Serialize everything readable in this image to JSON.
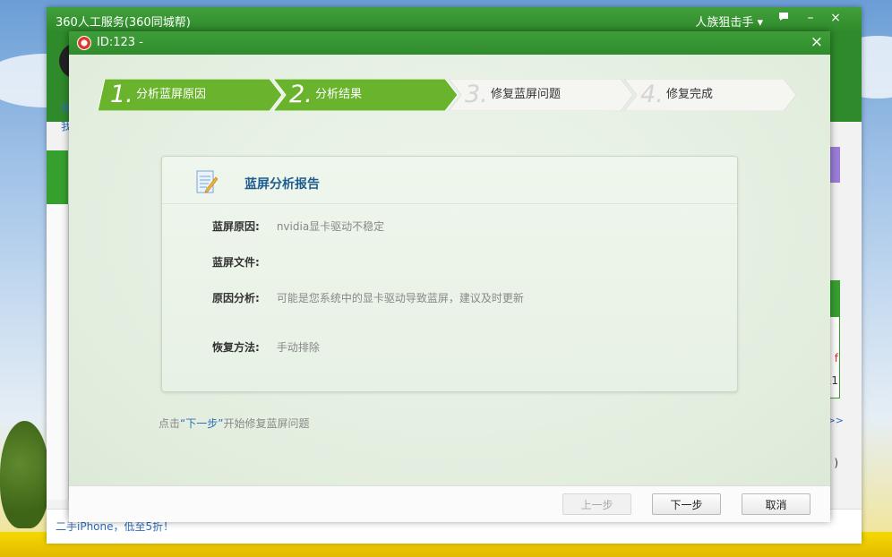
{
  "background": {
    "back_window": {
      "title": "360人工服务(360同城帮)",
      "user_menu": "人族狙击手",
      "feedback_icon": "chat-icon",
      "minimize_icon": "minus",
      "close_icon": "×",
      "side_text_1": "我",
      "side_text_2": "我",
      "right_link": ">>",
      "right_char_1": "f",
      "right_char_2": "11",
      "right_char_3": ")",
      "bottom_link": "二手iPhone，低至5折！"
    }
  },
  "dialog": {
    "title": "ID:123 -",
    "close_label": "×",
    "steps": [
      {
        "num": "1.",
        "label": "分析蓝屏原因",
        "state": "done"
      },
      {
        "num": "2.",
        "label": "分析结果",
        "state": "done"
      },
      {
        "num": "3.",
        "label": "修复蓝屏问题",
        "state": "todo"
      },
      {
        "num": "4.",
        "label": "修复完成",
        "state": "todo"
      }
    ],
    "report": {
      "title": "蓝屏分析报告",
      "rows": [
        {
          "key": "蓝屏原因:",
          "value": "nvidia显卡驱动不稳定"
        },
        {
          "key": "蓝屏文件:",
          "value": ""
        },
        {
          "key": "原因分析:",
          "value": "可能是您系统中的显卡驱动导致蓝屏，建议及时更新"
        },
        {
          "key": "恢复方法:",
          "value": "手动排除"
        }
      ]
    },
    "hint": {
      "prefix": "点击",
      "highlight": "“下一步”",
      "suffix": "开始修复蓝屏问题"
    },
    "buttons": {
      "prev": "上一步",
      "next": "下一步",
      "cancel": "取消"
    }
  },
  "colors": {
    "green": "#3f9e39",
    "step_done": "#6ab42d",
    "link_blue": "#2f6fb7",
    "title_blue": "#1f5d8f"
  }
}
